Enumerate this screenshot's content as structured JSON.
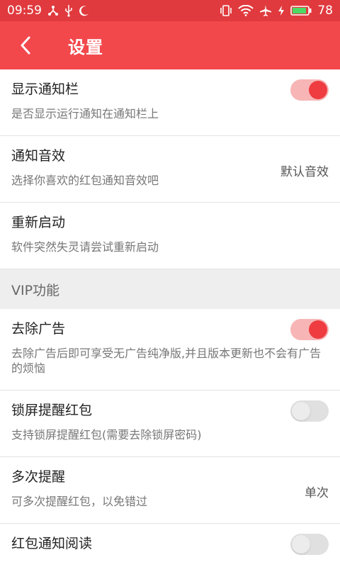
{
  "status_bar": {
    "time": "09:59",
    "battery_level": "78",
    "left_icons": [
      "share-nodes-icon",
      "usb-icon",
      "moon-icon"
    ],
    "right_icons": [
      "vibrate-icon",
      "wifi-icon",
      "airplane-icon",
      "charging-icon",
      "battery-icon"
    ]
  },
  "app_bar": {
    "title": "设置",
    "back_icon": "chevron-left-icon"
  },
  "settings": {
    "notify_bar": {
      "title": "显示通知栏",
      "subtitle": "是否显示运行通知在通知栏上",
      "enabled": true
    },
    "notify_sound": {
      "title": "通知音效",
      "subtitle": "选择你喜欢的红包通知音效吧",
      "value": "默认音效"
    },
    "restart": {
      "title": "重新启动",
      "subtitle": "软件突然失灵请尝试重新启动"
    }
  },
  "vip": {
    "header": "VIP功能",
    "remove_ads": {
      "title": "去除广告",
      "subtitle": "去除广告后即可享受无广告纯净版,并且版本更新也不会有广告的烦恼",
      "enabled": true
    },
    "lock_screen": {
      "title": "锁屏提醒红包",
      "subtitle": "支持锁屏提醒红包(需要去除锁屏密码)",
      "enabled": false
    },
    "multi_remind": {
      "title": "多次提醒",
      "subtitle": "可多次提醒红包，以免错过",
      "value": "单次"
    },
    "notify_read": {
      "title": "红包通知阅读",
      "enabled": false
    }
  },
  "colors": {
    "accent": "#f2484c",
    "status_bar": "#e03a3e",
    "toggle_on_knob": "#ee3c41",
    "toggle_on_track": "#f7b5b6",
    "section_bg": "#eeeeee"
  }
}
